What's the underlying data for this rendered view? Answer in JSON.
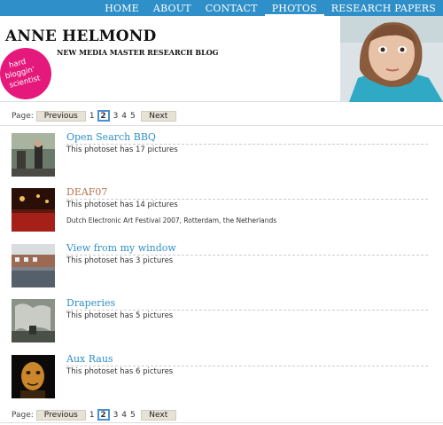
{
  "nav": {
    "items": [
      {
        "label": "HOME",
        "active": false
      },
      {
        "label": "ABOUT",
        "active": false
      },
      {
        "label": "CONTACT",
        "active": false
      },
      {
        "label": "PHOTOS",
        "active": true
      },
      {
        "label": "RESEARCH PAPERS",
        "active": false
      }
    ]
  },
  "header": {
    "title": "ANNE HELMOND",
    "subtitle": "NEW MEDIA MASTER RESEARCH BLOG",
    "badge": [
      "hard",
      "bloggin'",
      "scientist"
    ]
  },
  "pager": {
    "label": "Page:",
    "previous": "Previous",
    "next": "Next",
    "pages": [
      "1",
      "2",
      "3",
      "4",
      "5"
    ],
    "current": "2"
  },
  "photosets": [
    {
      "title": "Open Search BBQ",
      "count_text": "This photoset has 17 pictures",
      "description": "",
      "visited": false
    },
    {
      "title": "DEAF07",
      "count_text": "This photoset has 14 pictures",
      "description": "Dutch Electronic Art Festival 2007, Rotterdam, the Netherlands",
      "visited": true
    },
    {
      "title": "View from my window",
      "count_text": "This photoset has 3 pictures",
      "description": "",
      "visited": false
    },
    {
      "title": "Draperies",
      "count_text": "This photoset has 5 pictures",
      "description": "",
      "visited": false
    },
    {
      "title": "Aux Raus",
      "count_text": "This photoset has 6 pictures",
      "description": "",
      "visited": false
    }
  ],
  "colors": {
    "nav_bg": "#2f8fc8",
    "link": "#2f8fc8",
    "visited_link": "#b5714c",
    "badge": "#e5197c"
  }
}
